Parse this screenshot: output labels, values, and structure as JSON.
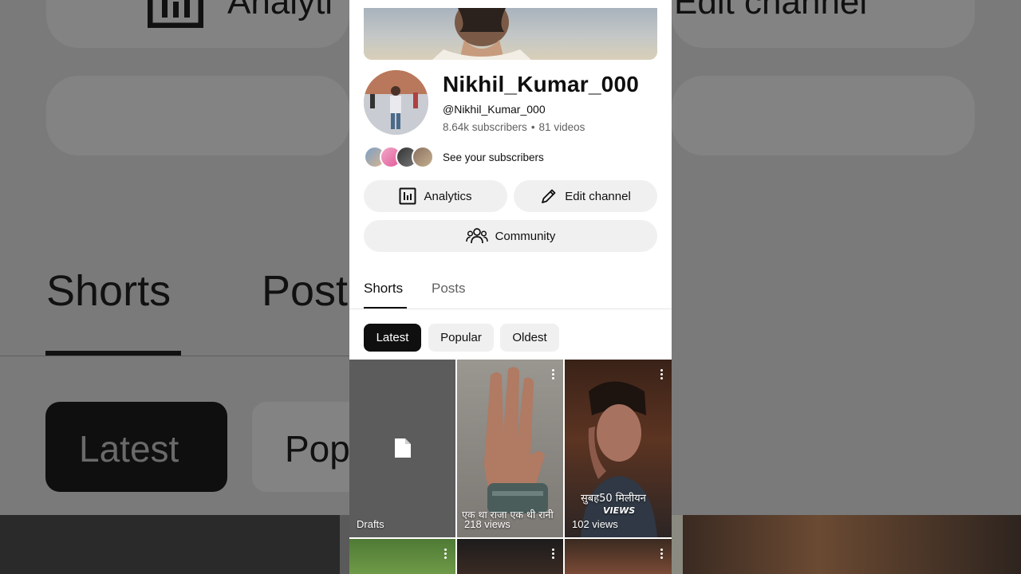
{
  "channel": {
    "name": "Nikhil_Kumar_000",
    "handle": "@Nikhil_Kumar_000",
    "subscribers": "8.64k subscribers",
    "separator": "•",
    "videos": "81 videos",
    "see_subscribers": "See your subscribers"
  },
  "actions": {
    "analytics_label": "Analytics",
    "edit_label": "Edit channel",
    "community_label": "Community"
  },
  "tabs": [
    {
      "label": "Shorts",
      "active": true
    },
    {
      "label": "Posts",
      "active": false
    }
  ],
  "filters": [
    {
      "label": "Latest",
      "selected": true
    },
    {
      "label": "Popular",
      "selected": false
    },
    {
      "label": "Oldest",
      "selected": false
    }
  ],
  "grid": {
    "tiles": [
      {
        "label": "Drafts",
        "icon": "draft-file-icon"
      },
      {
        "label": "218 views",
        "overlay": "एक था राजा एक थी रानी"
      },
      {
        "label": "102 views",
        "overlay_line1": "सुबह50 मिलीयन",
        "overlay_line2": "VIEWS"
      }
    ]
  },
  "background": {
    "analytics_partial": "Analyti",
    "edit_partial": "Edit channel",
    "shorts": "Shorts",
    "posts_partial": "Post",
    "latest": "Latest",
    "popular_partial": "Pop"
  },
  "colors": {
    "accent": "#0f0f0f",
    "chip_bg": "#f0f0f0",
    "secondary_text": "#606060"
  }
}
